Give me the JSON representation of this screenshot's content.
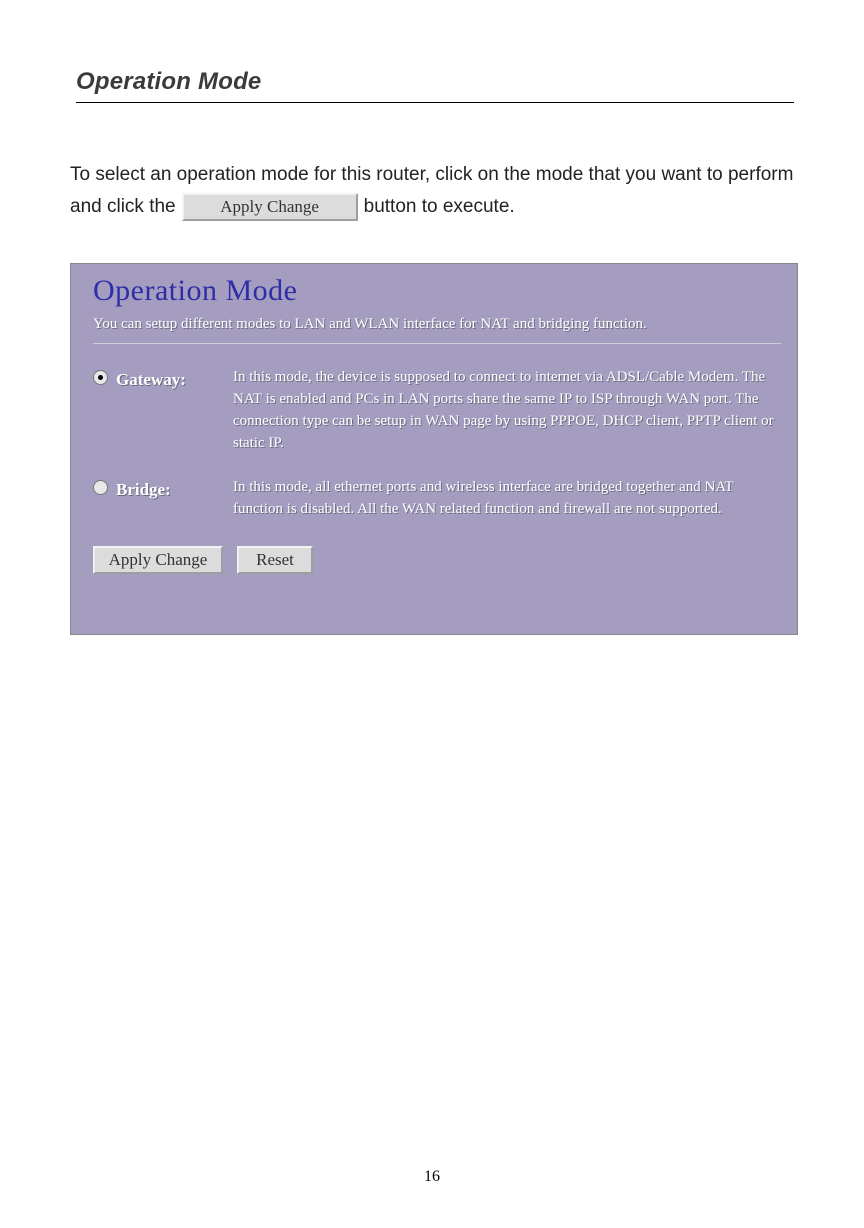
{
  "heading": "Operation Mode",
  "intro": {
    "line1": "To select an operation mode for this router, click on the mode that you want to perform",
    "prefix": "and click the",
    "inline_button": "Apply Change",
    "suffix": "button to execute."
  },
  "panel": {
    "title": "Operation Mode",
    "subtitle": "You can setup different modes to LAN and WLAN interface for NAT and bridging function.",
    "modes": [
      {
        "label": "Gateway:",
        "selected": true,
        "desc": "In this mode, the device is supposed to connect to internet via ADSL/Cable Modem. The NAT is enabled and PCs in LAN ports share the same IP to ISP through WAN port. The connection type can be setup in WAN page by using PPPOE, DHCP client, PPTP client or static IP."
      },
      {
        "label": "Bridge:",
        "selected": false,
        "desc": "In this mode, all ethernet ports and wireless interface are bridged together and NAT function is disabled. All the WAN related function and firewall are not supported."
      }
    ],
    "buttons": {
      "apply": "Apply Change",
      "reset": "Reset"
    }
  },
  "page_number": "16"
}
